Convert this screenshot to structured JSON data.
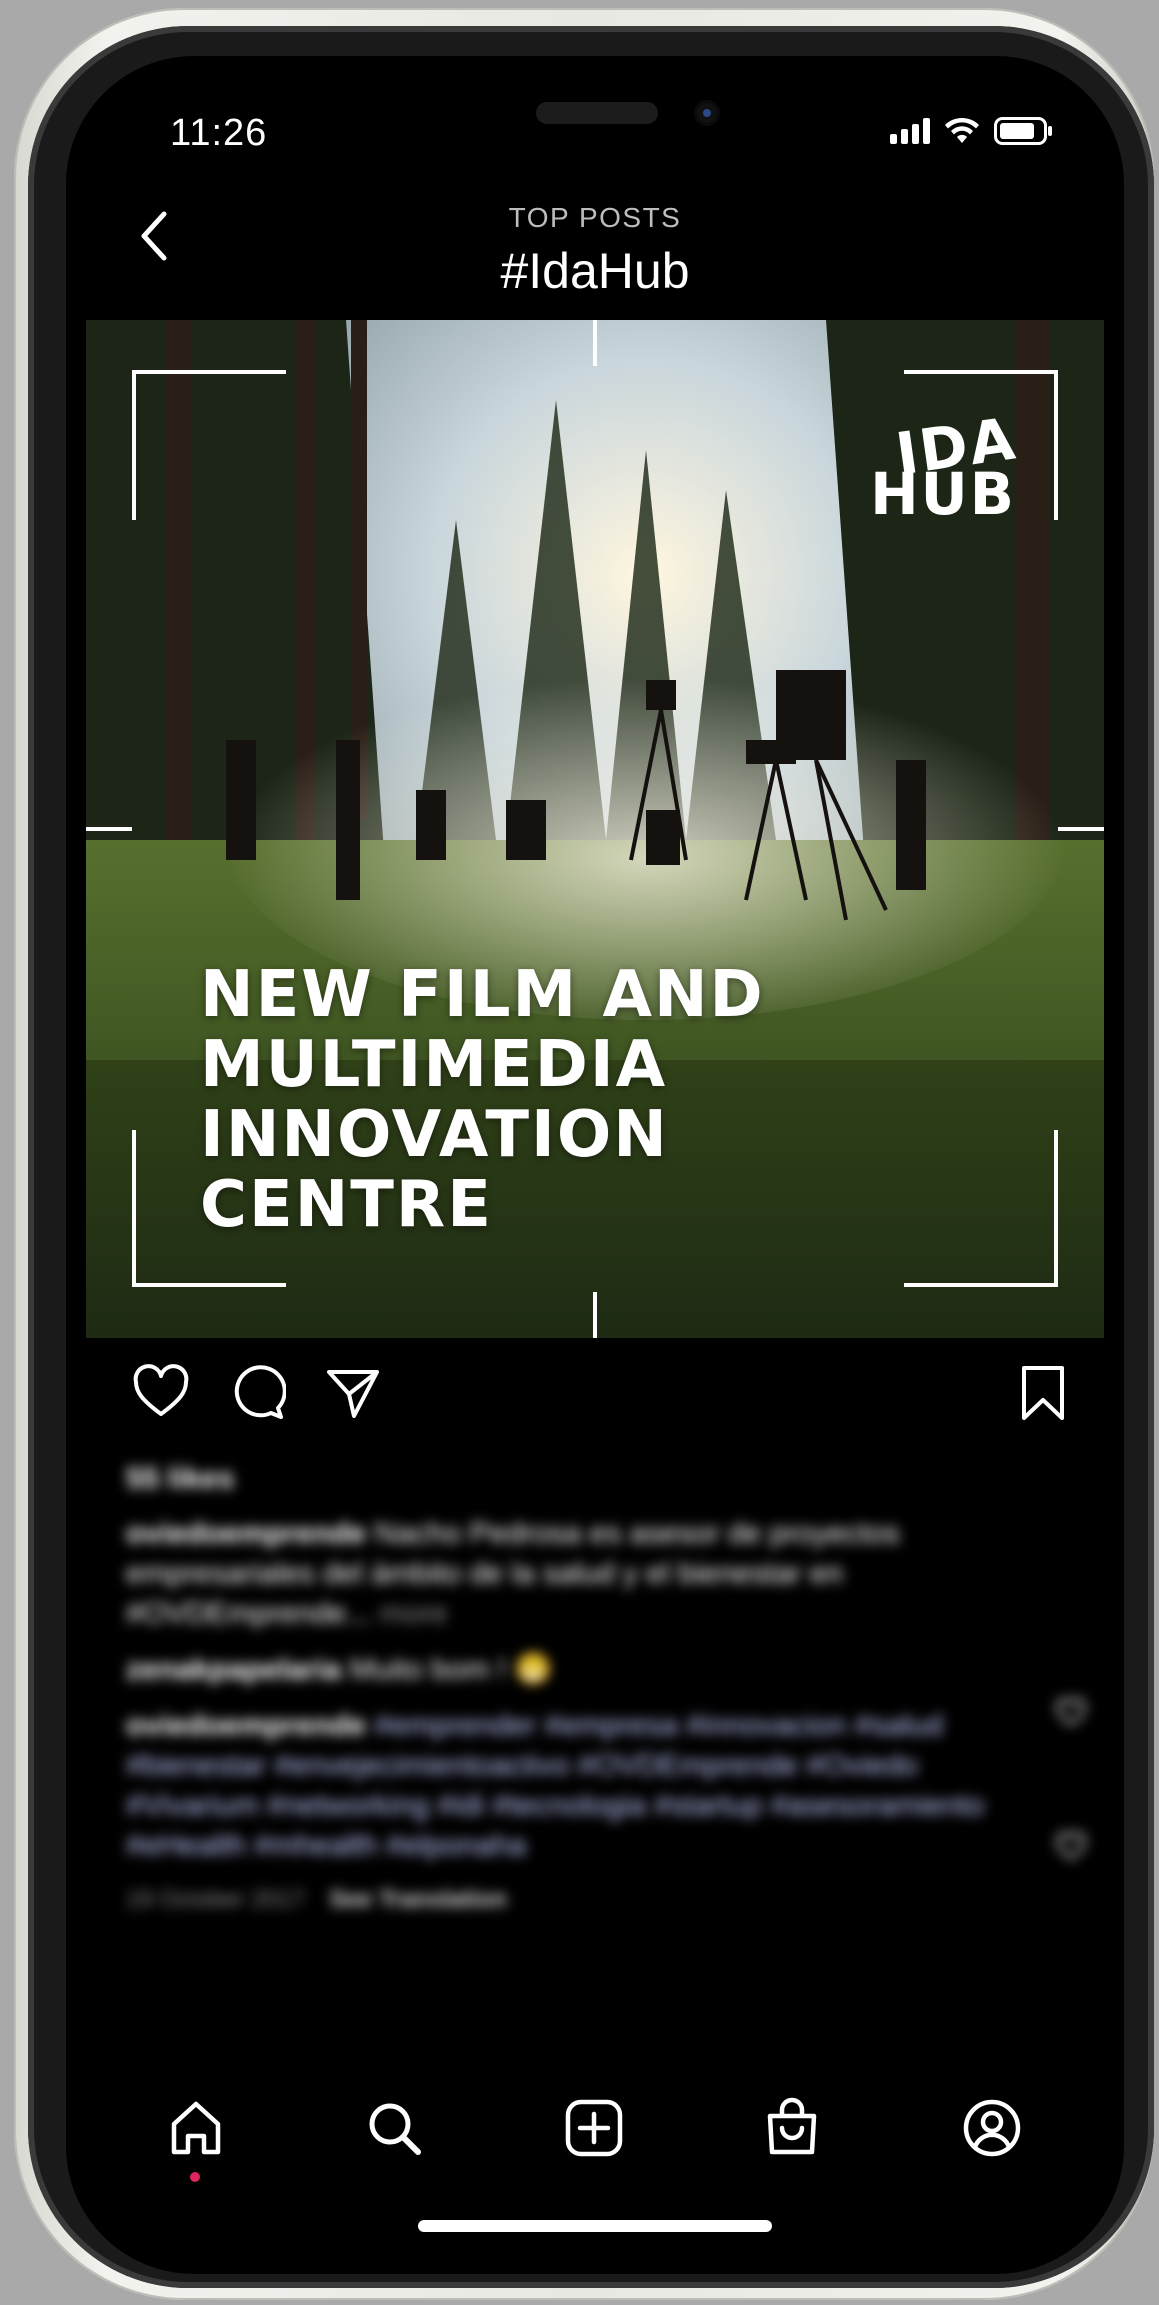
{
  "status_bar": {
    "time": "11:26"
  },
  "header": {
    "subtitle": "TOP POSTS",
    "title": "#IdaHub"
  },
  "post": {
    "brand_logo": {
      "line1": "IDA",
      "line2": "HUB"
    },
    "headline": [
      "NEW FILM AND",
      "MULTIMEDIA",
      "INNOVATION",
      "CENTRE"
    ],
    "likes": "55 likes",
    "caption": {
      "user": "oviedoemprende",
      "text": "Nacho Pedrosa es asesor de proyectos empresariales del ámbito de la salud y el bienestar en #OVDEmprende...",
      "more": "more"
    },
    "comments": [
      {
        "user": "zenakpapelaria",
        "text": "Muito bom ! 😁"
      },
      {
        "user": "oviedoemprende",
        "text": "#emprender #empresa #innovacion #salud #bienestar #envejecimientoactivo #OVDEmprende #Oviedo #Vivarium #networking #idi #tecnologia #startup #asesoramiento #eHealth #mhealth #elponaha"
      }
    ],
    "date": "19 October 2017",
    "see_translation": "See Translation"
  },
  "icons": {
    "back": "chevron-left-icon",
    "like": "heart-icon",
    "comment": "comment-icon",
    "share": "send-icon",
    "save": "bookmark-icon",
    "tabs": [
      "home-icon",
      "search-icon",
      "add-post-icon",
      "shop-bag-icon",
      "profile-icon"
    ]
  },
  "colors": {
    "background": "#000000",
    "text": "#ffffff",
    "notification_dot": "#e0245e"
  }
}
